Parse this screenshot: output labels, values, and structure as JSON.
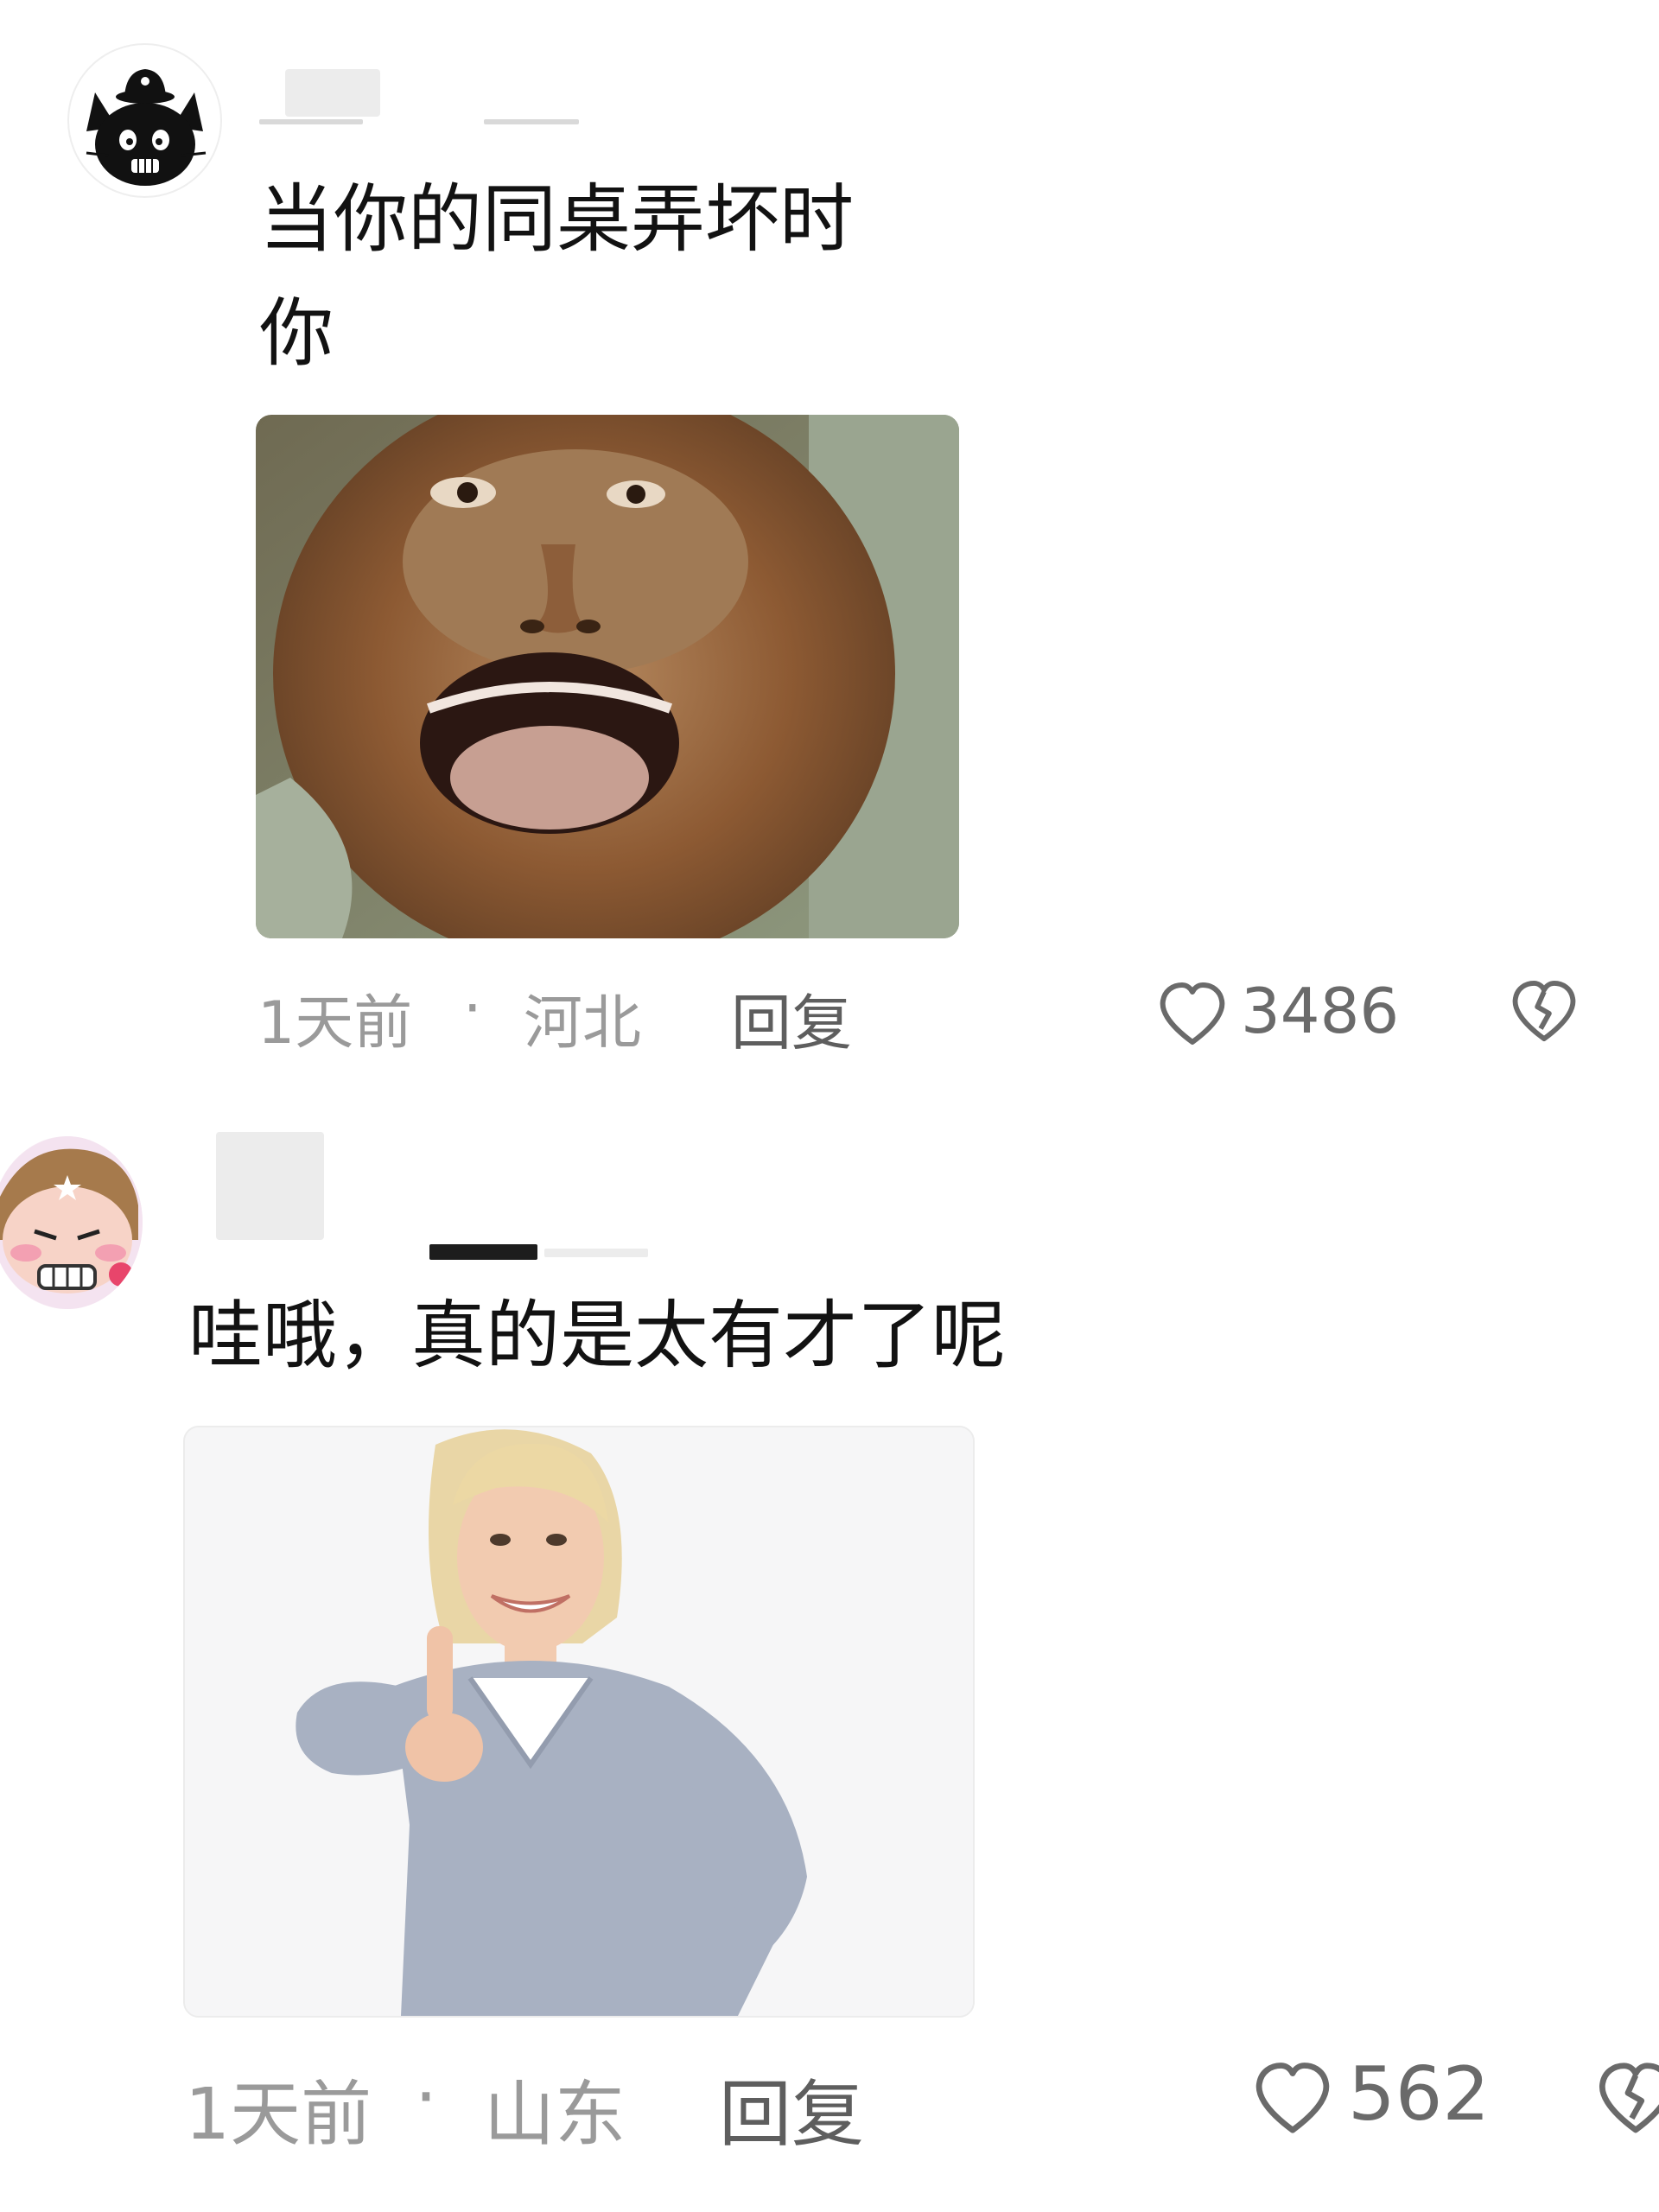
{
  "comments": [
    {
      "text": "当你的同桌弄坏时\n你",
      "meta": {
        "time": "1天前",
        "separator": "·",
        "location": "河北",
        "reply_label": "回复"
      },
      "likes": "3486",
      "image_icon": "monkey-face-meme-image"
    },
    {
      "text": "哇哦，真的是太有才了呢",
      "meta": {
        "time": "1天前",
        "separator": "·",
        "location": "山东",
        "reply_label": "回复"
      },
      "likes": "562",
      "image_icon": "thumbs-up-woman-image"
    }
  ],
  "icons": {
    "like": "heart-outline-icon",
    "dislike": "broken-heart-icon"
  },
  "colors": {
    "meta_text": "#9a9a9a",
    "reply_text": "#5e5e5e",
    "icon_stroke": "#6a6a6a"
  }
}
